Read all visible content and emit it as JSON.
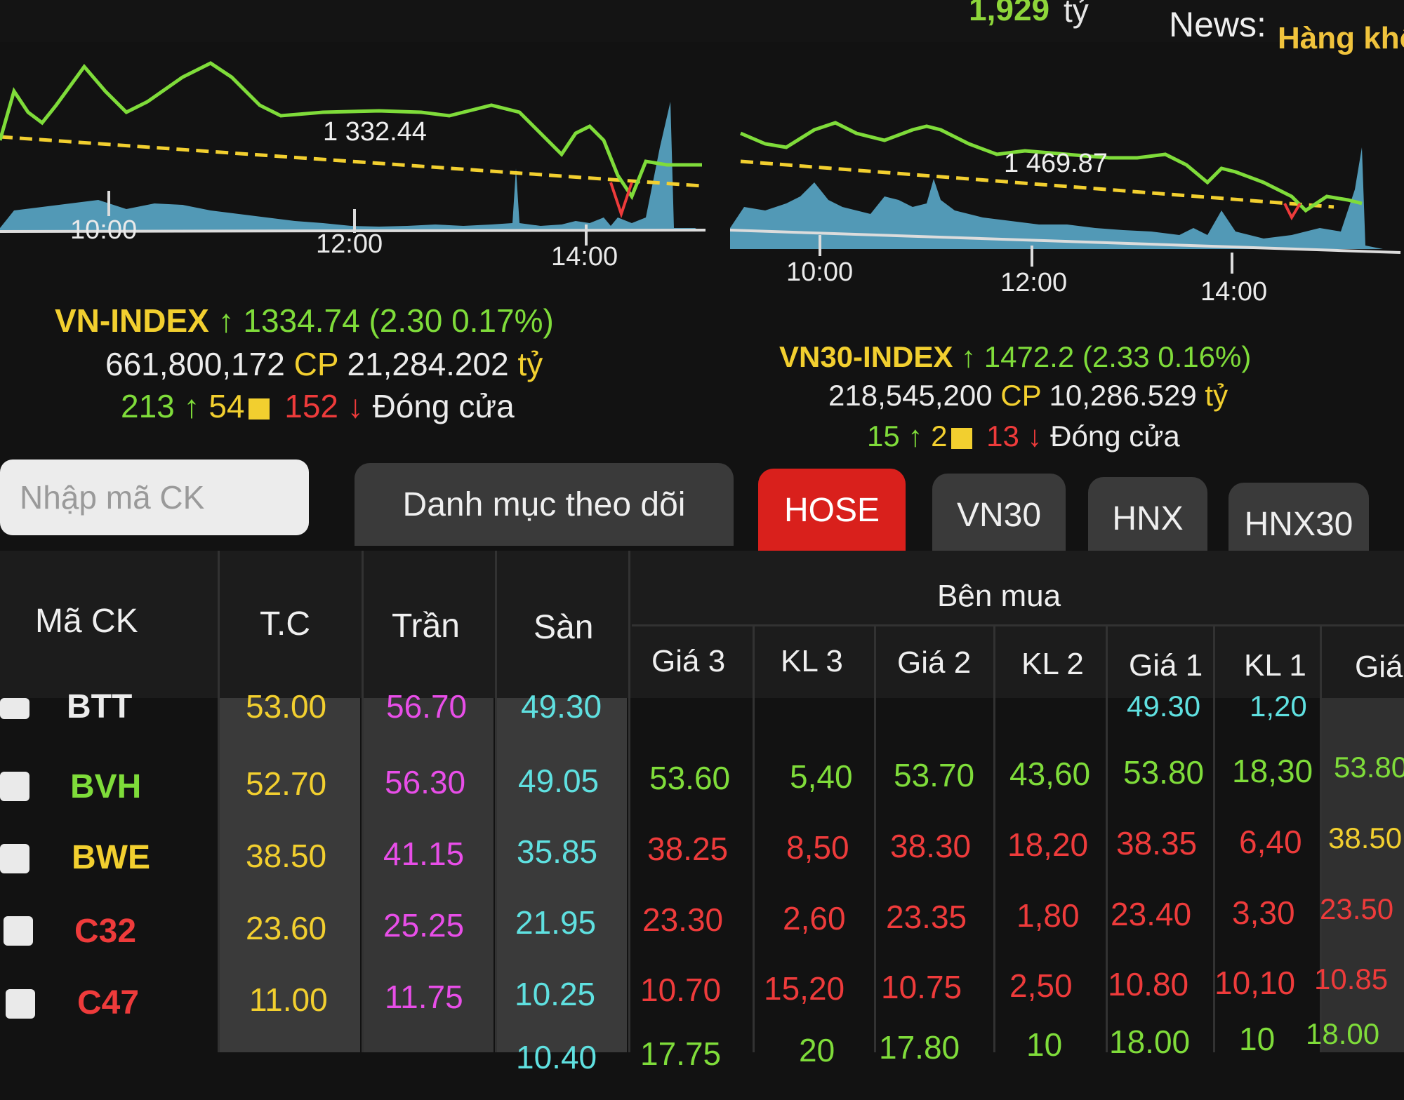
{
  "top": {
    "value": "1,929",
    "unit": "tỷ",
    "news_label": "News:",
    "news_text": "Hàng khô"
  },
  "charts": [
    {
      "ref": "1 332.44",
      "ticks": [
        "10:00",
        "12:00",
        "14:00"
      ]
    },
    {
      "ref": "1 469.87",
      "ticks": [
        "10:00",
        "12:00",
        "14:00"
      ]
    }
  ],
  "vnindex": {
    "name": "VN-INDEX",
    "arrow": "↑",
    "value": "1334.74",
    "change": "(2.30  0.17%)",
    "volume": "661,800,172",
    "cp": "CP",
    "turnover": "21,284.202",
    "unit": "tỷ",
    "up": "213",
    "up_arrow": "↑",
    "ref": "54",
    "down": "152",
    "down_arrow": "↓",
    "status": "Đóng cửa"
  },
  "vn30": {
    "name": "VN30-INDEX",
    "arrow": "↑",
    "value": "1472.2",
    "change": "(2.33  0.16%)",
    "volume": "218,545,200",
    "cp": "CP",
    "turnover": "10,286.529",
    "unit": "tỷ",
    "up": "15",
    "up_arrow": "↑",
    "ref": "2",
    "down": "13",
    "down_arrow": "↓",
    "status": "Đóng cửa"
  },
  "search": {
    "placeholder": "Nhập mã CK"
  },
  "tabs": [
    "Danh mục theo dõi",
    "HOSE",
    "VN30",
    "HNX",
    "HNX30"
  ],
  "table": {
    "headers": {
      "code": "Mã CK",
      "ref": "T.C",
      "ceil": "Trần",
      "floor": "Sàn",
      "buy_group": "Bên mua",
      "cols": [
        "Giá 3",
        "KL 3",
        "Giá 2",
        "KL 2",
        "Giá 1",
        "KL 1",
        "Giá"
      ]
    },
    "rows": [
      {
        "code": "BTT",
        "ref": "53.00",
        "ceil": "56.70",
        "floor": "49.30",
        "bids": [
          "",
          "",
          "",
          "",
          "49.30",
          "1,20",
          ""
        ]
      },
      {
        "code": "BVH",
        "ref": "52.70",
        "ceil": "56.30",
        "floor": "49.05",
        "bids": [
          "53.60",
          "5,40",
          "53.70",
          "43,60",
          "53.80",
          "18,30",
          "53.80"
        ]
      },
      {
        "code": "BWE",
        "ref": "38.50",
        "ceil": "41.15",
        "floor": "35.85",
        "bids": [
          "38.25",
          "8,50",
          "38.30",
          "18,20",
          "38.35",
          "6,40",
          "38.50"
        ]
      },
      {
        "code": "C32",
        "ref": "23.60",
        "ceil": "25.25",
        "floor": "21.95",
        "bids": [
          "23.30",
          "2,60",
          "23.35",
          "1,80",
          "23.40",
          "3,30",
          "23.50"
        ]
      },
      {
        "code": "C47",
        "ref": "11.00",
        "ceil": "11.75",
        "floor": "10.25",
        "bids": [
          "10.70",
          "15,20",
          "10.75",
          "2,50",
          "10.80",
          "10,10",
          "10.85"
        ]
      },
      {
        "code": "",
        "ref": "",
        "ceil": "",
        "floor": "10.40",
        "bids": [
          "17.75",
          "20",
          "17.80",
          "10",
          "18.00",
          "10",
          "18.00"
        ]
      }
    ]
  },
  "colors": {
    "up": "#7fdc3a",
    "down": "#ee3b3b",
    "ref": "#f2cf2f",
    "ceil": "#e84ee8",
    "floor": "#5fe0e0",
    "active_tab": "#d9201c"
  }
}
